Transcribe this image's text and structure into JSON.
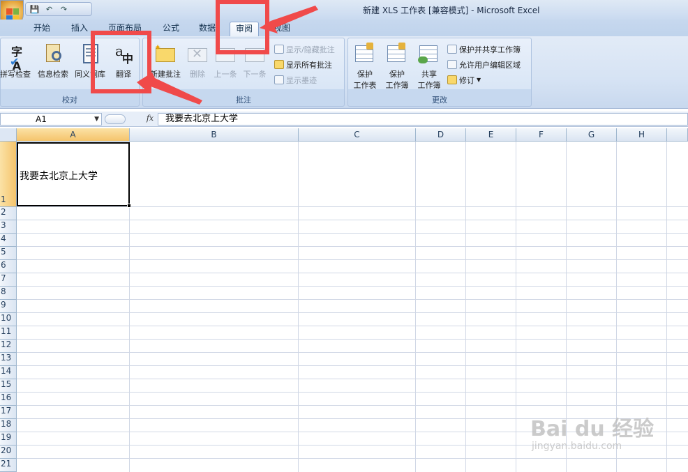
{
  "window": {
    "title": "新建 XLS 工作表  [兼容模式] - Microsoft Excel"
  },
  "qat": {
    "save_icon": "save-icon",
    "undo_icon": "undo-icon",
    "redo_icon": "redo-icon"
  },
  "tabs": [
    {
      "label": "开始"
    },
    {
      "label": "插入"
    },
    {
      "label": "页面布局"
    },
    {
      "label": "公式"
    },
    {
      "label": "数据"
    },
    {
      "label": "审阅"
    },
    {
      "label": "视图"
    }
  ],
  "ribbon": {
    "proofing": {
      "name": "校对",
      "spell": "拼写检查",
      "research": "信息检索",
      "thesaurus": "同义词库",
      "translate": "翻译"
    },
    "comments": {
      "name": "批注",
      "new": "新建批注",
      "delete": "删除",
      "prev": "上一条",
      "next": "下一条",
      "show_hide": "显示/隐藏批注",
      "show_all": "显示所有批注",
      "show_ink": "显示墨迹"
    },
    "changes": {
      "name": "更改",
      "protect_sheet_1": "保护",
      "protect_sheet_2": "工作表",
      "protect_book_1": "保护",
      "protect_book_2": "工作簿",
      "share_book_1": "共享",
      "share_book_2": "工作簿",
      "protect_share": "保护并共享工作簿",
      "allow_edit": "允许用户编辑区域",
      "track": "修订"
    }
  },
  "formula_bar": {
    "name_box": "A1",
    "fx": "fx",
    "content": "我要去北京上大学"
  },
  "columns": [
    "A",
    "B",
    "C",
    "D",
    "E",
    "F",
    "G",
    "H"
  ],
  "rows": [
    "1",
    "2",
    "3",
    "4",
    "5",
    "6",
    "7",
    "8",
    "9",
    "10",
    "11",
    "12",
    "13",
    "14",
    "15",
    "16",
    "17",
    "18",
    "19",
    "20",
    "21"
  ],
  "cells": {
    "A1": "我要去北京上大学"
  },
  "watermark": {
    "line1": "Bai du 经验",
    "line2": "jingyan.baidu.com"
  },
  "colors": {
    "annotation": "#f04a4a",
    "selection": "#f5c46c",
    "ribbon": "#d6e3f4"
  }
}
